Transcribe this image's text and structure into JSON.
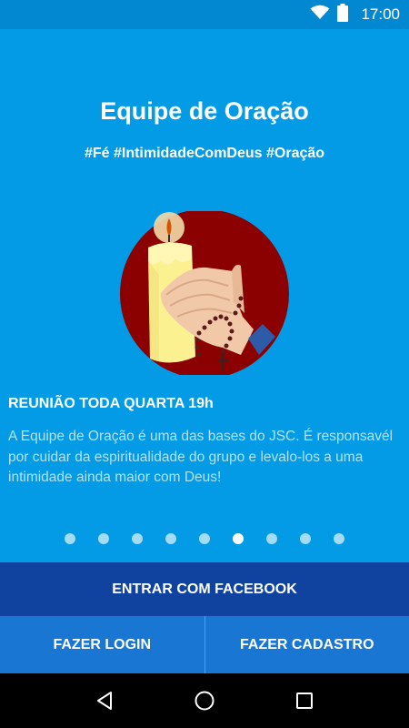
{
  "status_bar": {
    "time": "17:00",
    "icons": [
      "wifi-icon",
      "battery-icon"
    ]
  },
  "slide": {
    "title": "Equipe de Oração",
    "hashtags": "#Fé #IntimidadeComDeus #Oração",
    "illustration_icon": "candle-praying-hands-rosary",
    "meeting": "REUNIÃO TODA QUARTA 19h",
    "description": "A Equipe de Oração é uma das bases do JSC. É responsavél por cuidar da espiritualidade do grupo e levalo-los a uma intimidade ainda maior com Deus!"
  },
  "pager": {
    "total": 9,
    "active_index": 5
  },
  "actions": {
    "facebook_label": "ENTRAR COM FACEBOOK",
    "login_label": "FAZER LOGIN",
    "signup_label": "FAZER CADASTRO"
  },
  "colors": {
    "background": "#039be5",
    "status_bar": "#0288d1",
    "facebook_button": "#1043a0",
    "bottom_buttons": "#1976d2",
    "circle": "#8b0000"
  },
  "nav_bar": {
    "icons": [
      "back-icon",
      "home-icon",
      "recents-icon"
    ]
  }
}
